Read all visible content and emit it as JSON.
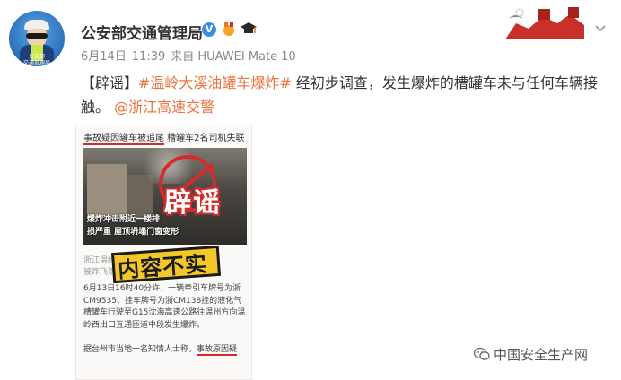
{
  "account": {
    "name": "公安部交通管理局",
    "avatar_badge": "公安部\n交通管理局"
  },
  "meta": {
    "date": "6月14日",
    "time": "11:39",
    "source_prefix": "来自",
    "source": "HUAWEI Mate 10"
  },
  "post": {
    "prefix": "【辟谣】",
    "hashtag": "#温岭大溪油罐车爆炸#",
    "body": " 经初步调查，发生爆炸的槽罐车未与任何车辆接触。",
    "mention": "@浙江高速交警"
  },
  "card": {
    "headline_underlined": "事故疑因罐车被追尾",
    "headline_rest": " 槽罐车2名司机失联",
    "photo_caption_1": "爆炸冲击附近一楼排",
    "photo_caption_2": "损严重 屋顶坍塌门窗变形",
    "stamp": "辟谣",
    "gray_line_1": "浙江温岭",
    "gray_line_2": "被炸飞落",
    "fake_stamp": "内容不实",
    "article_p1": "6月13日16时40分许，一辆牵引车牌号为浙CM9535、挂车牌号为浙CM138挂的液化气槽罐车行驶至G15沈海高速公路往温州方向温岭西出口互通匝道中段发生爆炸。",
    "article_p2_start": "据台州市当地一名知情人士称，",
    "article_p2_underlined": "事故原因疑"
  },
  "watermark": {
    "text": "中国安全生产网"
  },
  "colors": {
    "accent": "#eb7340",
    "verify_blue": "#3b8fe0",
    "stamp_red": "#d62b2b",
    "fake_yellow": "#f3c728"
  },
  "icons": {
    "verified": "verified-badge-icon",
    "medal": "medal-icon",
    "graduation": "graduation-cap-icon",
    "more": "chevron-down-icon",
    "banner": "great-wall-banner-icon",
    "wechat": "wechat-icon"
  }
}
